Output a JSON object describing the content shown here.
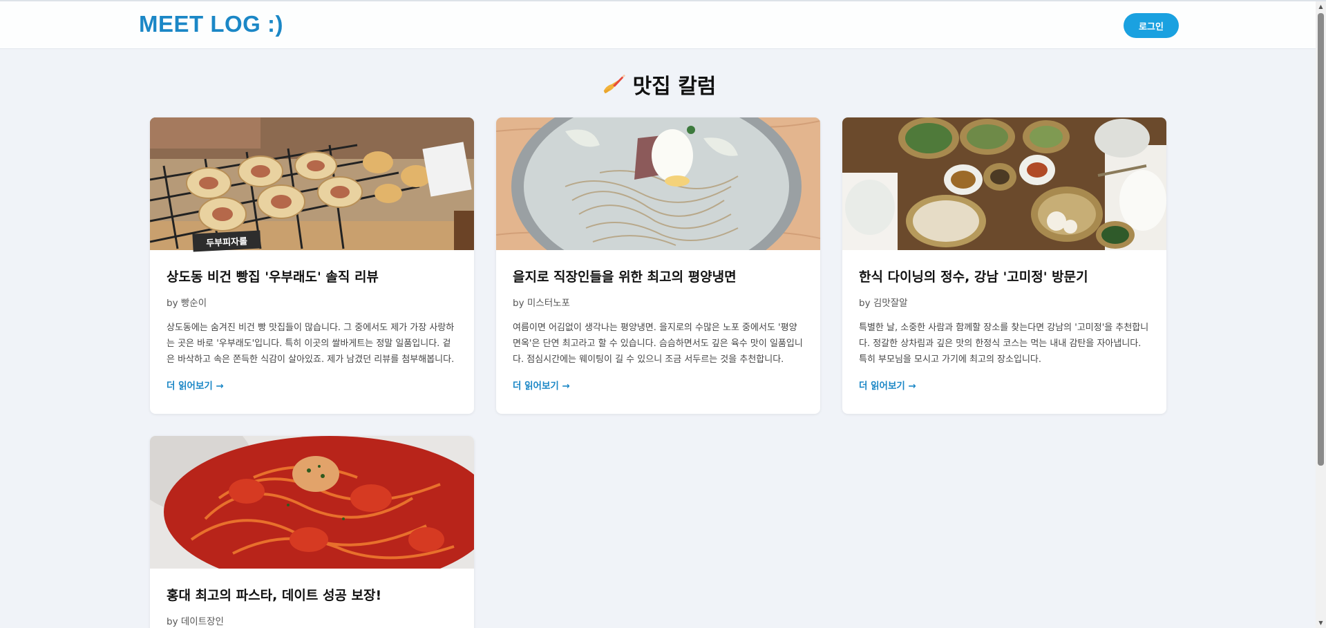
{
  "header": {
    "logo": "MEET LOG :)",
    "login_label": "로그인"
  },
  "page": {
    "title": "맛집 칼럼",
    "title_icon": "writing-hand-icon"
  },
  "columns": [
    {
      "title": "상도동 비건 빵집 '우부래도' 솔직 리뷰",
      "author": "by 빵순이",
      "excerpt": "상도동에는 숨겨진 비건 빵 맛집들이 많습니다. 그 중에서도 제가 가장 사랑하는 곳은 바로 '우부래도'입니다. 특히 이곳의 쌀바게트는 정말 일품입니다. 겉은 바삭하고 속은 쫀득한 식감이 살아있죠. 제가 남겼던 리뷰를 첨부해봅니다. 여러분도 상도동에 가시면 꼭 들러보세요!",
      "image_label": "두부피자롤",
      "read_more": "더 읽어보기 →"
    },
    {
      "title": "을지로 직장인들을 위한 최고의 평양냉면",
      "author": "by 미스터노포",
      "excerpt": "여름이면 어김없이 생각나는 평양냉면. 을지로의 수많은 노포 중에서도 '평양면옥'은 단연 최고라고 할 수 있습니다. 슴슴하면서도 깊은 육수 맛이 일품입니다. 점심시간에는 웨이팅이 길 수 있으니 조금 서두르는 것을 추천합니다.",
      "read_more": "더 읽어보기 →"
    },
    {
      "title": "한식 다이닝의 정수, 강남 '고미정' 방문기",
      "author": "by 김맛잘알",
      "excerpt": "특별한 날, 소중한 사람과 함께할 장소를 찾는다면 강남의 '고미정'을 추천합니다. 정갈한 상차림과 깊은 맛의 한정식 코스는 먹는 내내 감탄을 자아냅니다. 특히 부모님을 모시고 가기에 최고의 장소입니다.",
      "read_more": "더 읽어보기 →"
    },
    {
      "title": "홍대 최고의 파스타, 데이트 성공 보장!",
      "author": "by 데이트장인"
    }
  ],
  "colors": {
    "accent": "#1b87c6",
    "button": "#1aa1e0",
    "background": "#f0f3f8"
  }
}
